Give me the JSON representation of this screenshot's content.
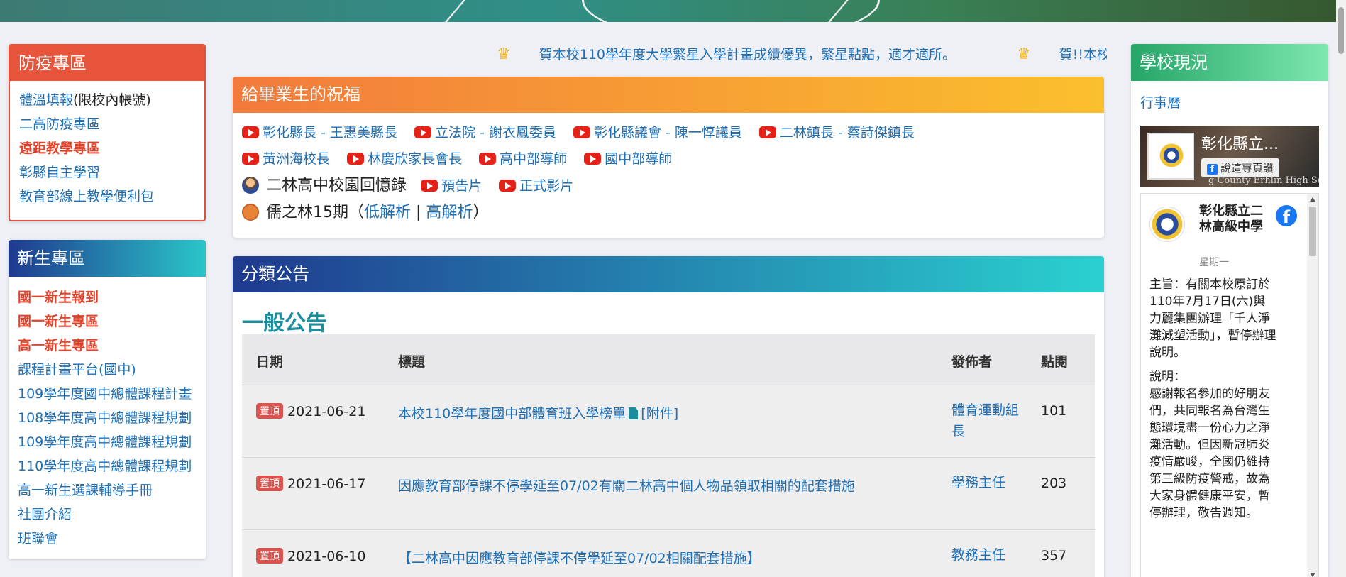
{
  "marquee": {
    "items": [
      "賀本校110學年度大學繁星入學計畫成績優異，繁星點點，適才適所。",
      "賀!!本校國中部"
    ]
  },
  "epidemic": {
    "title": "防疫專區",
    "items": [
      {
        "label": "體溫填報",
        "suffix": "(限校內帳號)"
      },
      {
        "label": "二高防疫專區"
      },
      {
        "label": "遠距教學專區"
      },
      {
        "label": "彰縣自主學習"
      },
      {
        "label": "教育部線上教學便利包"
      }
    ]
  },
  "newstudent": {
    "title": "新生專區",
    "items": [
      "國一新生報到",
      "國一新生專區",
      "高一新生專區",
      "課程計畫平台(國中)",
      "109學年度國中總體課程計畫",
      "108學年度高中總體課程規劃",
      "109學年度高中總體課程規劃",
      "110學年度高中總體課程規劃",
      "高一新生選課輔導手冊",
      "社團介紹",
      "班聯會"
    ]
  },
  "bless": {
    "title": "給畢業生的祝福",
    "row1": [
      "彰化縣長 - 王惠美縣長",
      "立法院 - 謝衣鳳委員",
      "彰化縣議會 - 陳一惇議員",
      "二林鎮長 - 蔡詩傑鎮長"
    ],
    "row2": [
      "黃洲海校長",
      "林慶欣家長會長",
      "高中部導師",
      "國中部導師"
    ],
    "memory_label": "二林高中校園回憶錄",
    "memory_links": [
      "預告片",
      "正式影片"
    ],
    "journal_label": "儒之林15期（",
    "journal_low": "低解析",
    "journal_sep": " | ",
    "journal_high": "高解析",
    "journal_end": "）"
  },
  "announce": {
    "title": "分類公告",
    "subtitle": "一般公告",
    "headers": {
      "date": "日期",
      "title": "標題",
      "publisher": "發佈者",
      "views": "點閱"
    },
    "pin_label": "置頂",
    "attachment_label": "[附件]",
    "rows": [
      {
        "date": "2021-06-21",
        "title": "本校110學年度國中部體育班入學榜單",
        "publisher": "體育運動組長",
        "views": "101"
      },
      {
        "date": "2021-06-17",
        "title": "因應教育部停課不停學延至07/02有關二林高中個人物品領取相關的配套措施",
        "publisher": "學務主任",
        "views": "203"
      },
      {
        "date": "2021-06-10",
        "title": "【二林高中因應教育部停課不停學延至07/02相關配套措施】",
        "publisher": "教務主任",
        "views": "357"
      }
    ]
  },
  "status": {
    "title": "學校現況",
    "calendar": "行事曆",
    "fb_name": "彰化縣立...",
    "fb_like": "說這專頁讚",
    "fb_strip": "g County Erhlin High School",
    "page_name": "彰化縣立二林高級中學",
    "page_date": "星期一",
    "post_p1": "主旨：有關本校原訂於110年7月17日(六)與力麗集團辦理「千人淨灘減塑活動」，暫停辦理說明。",
    "post_p2": "說明：",
    "post_p3": "感謝報名參加的好朋友們，共同報名為台灣生態環境盡一份心力之淨灘活動。但因新冠肺炎疫情嚴峻，全國仍維持第三級防疫警戒，故為大家身體健康平安，暫停辦理，敬告週知。"
  },
  "colors": {
    "accent_link": "#1f6fb5",
    "epidemic_red": "#e6553b",
    "announce_teal": "#1b8e9e"
  }
}
